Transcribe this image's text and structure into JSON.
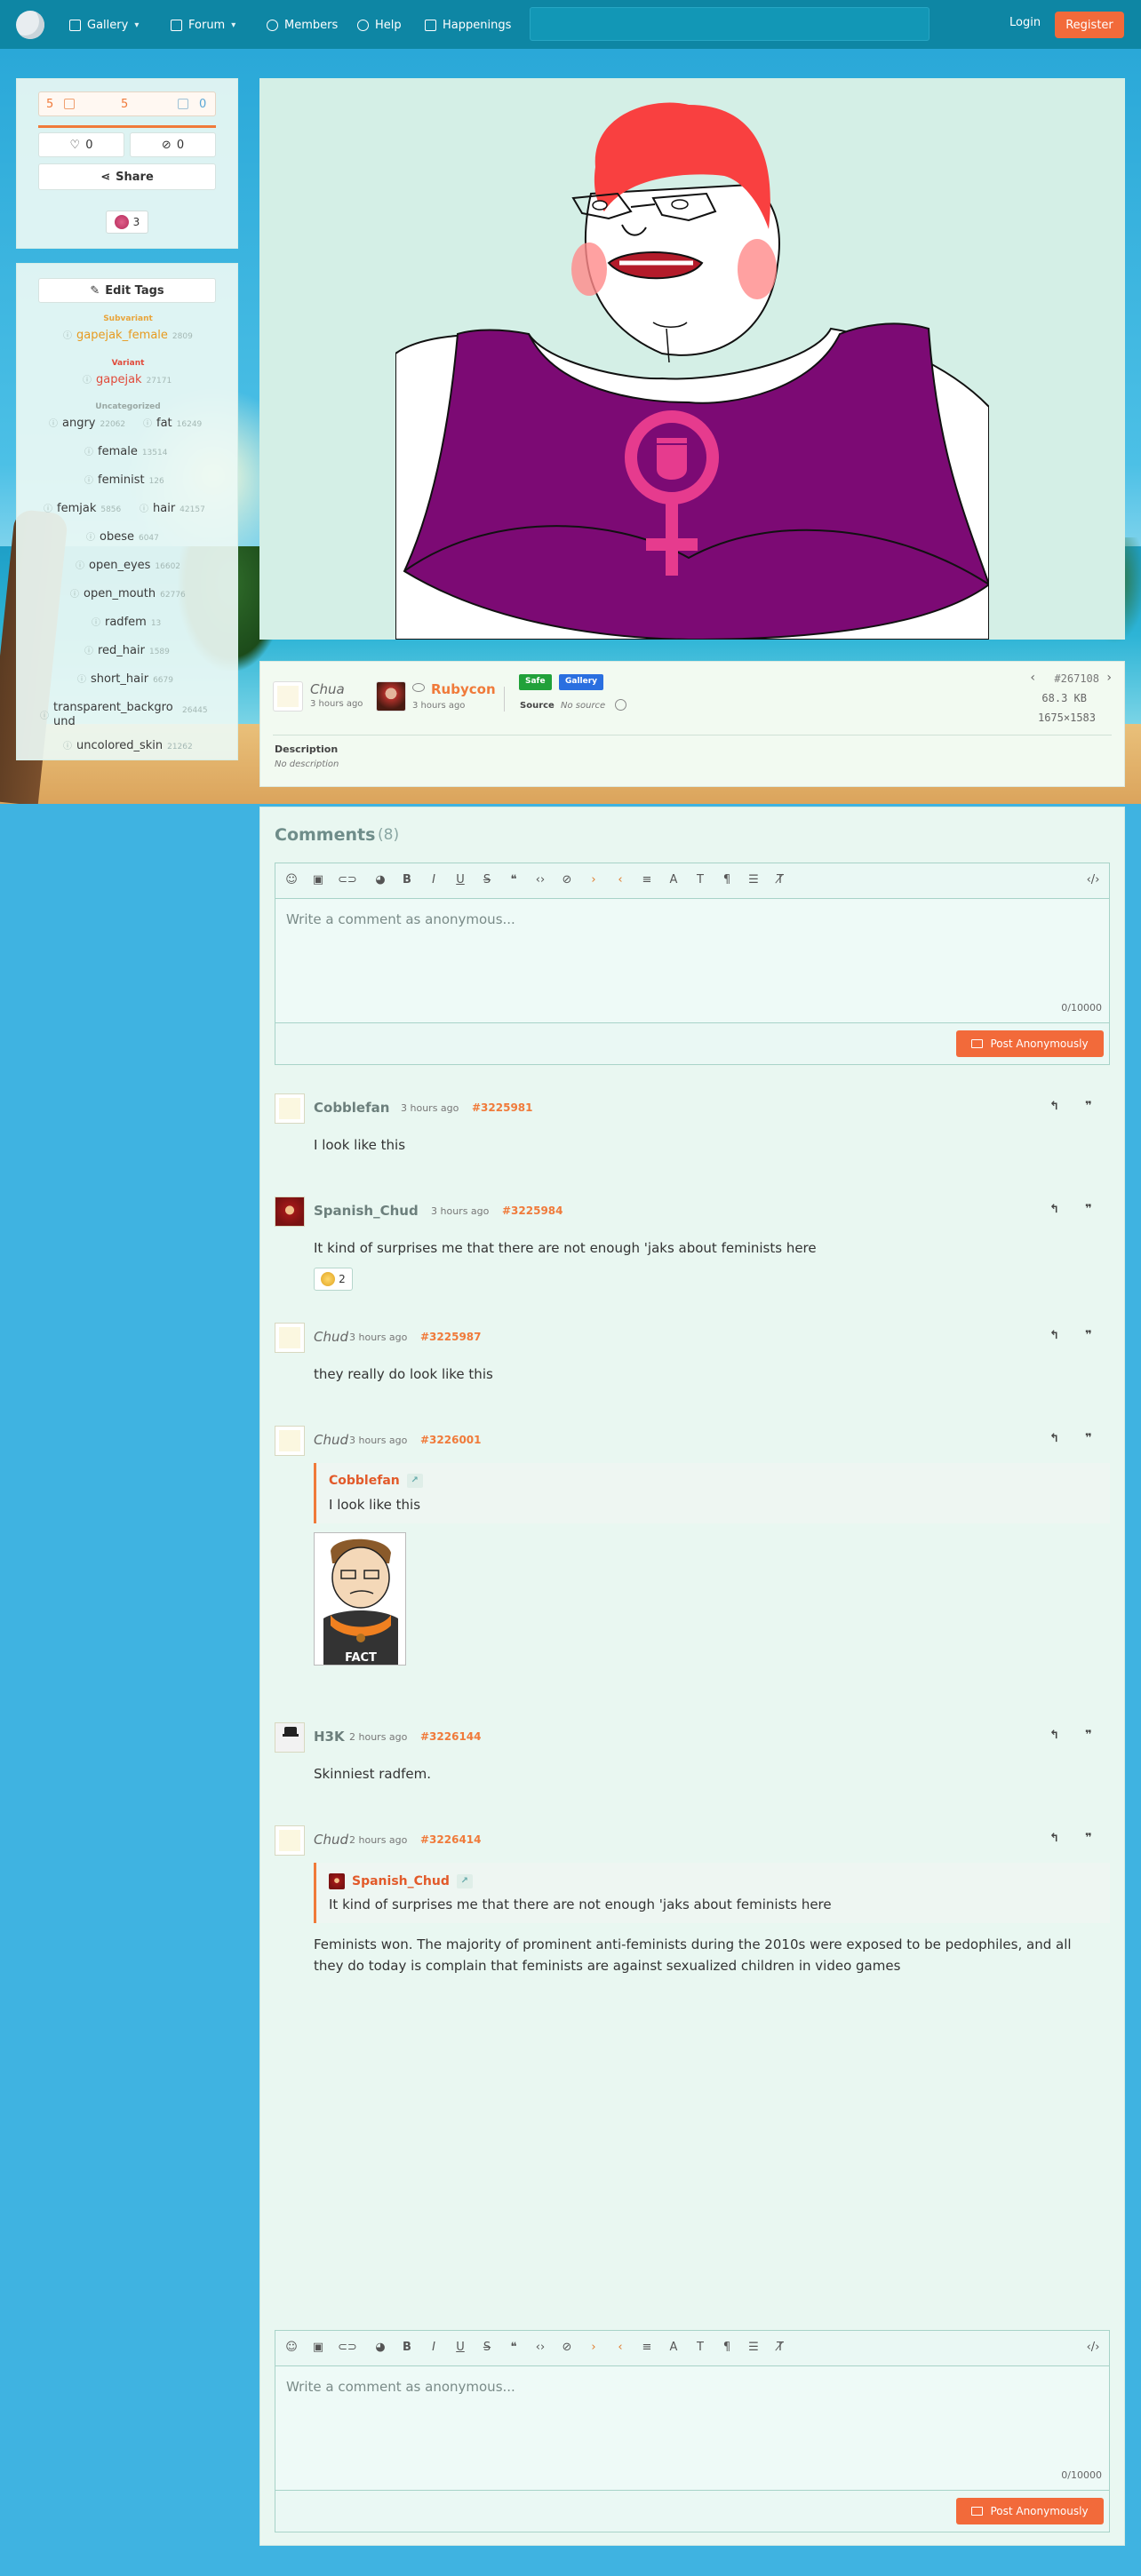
{
  "nav": {
    "items": [
      {
        "label": "Gallery",
        "has_dropdown": true,
        "icon": "image-icon"
      },
      {
        "label": "Forum",
        "has_dropdown": true,
        "icon": "chat-icon"
      },
      {
        "label": "Members",
        "has_dropdown": false,
        "icon": "user-icon"
      },
      {
        "label": "Help",
        "has_dropdown": false,
        "icon": "help-icon"
      },
      {
        "label": "Happenings",
        "has_dropdown": false,
        "icon": "book-icon"
      }
    ],
    "search_placeholder": "",
    "login_label": "Login",
    "register_label": "Register"
  },
  "vote": {
    "upvotes": "5",
    "score": "5",
    "downvotes": "0",
    "favorites": "0",
    "hides": "0",
    "share_label": "Share",
    "reaction_count": "3"
  },
  "tags": {
    "edit_label": "Edit Tags",
    "subvariant_heading": "Subvariant",
    "variant_heading": "Variant",
    "uncategorized_heading": "Uncategorized",
    "subvariant": [
      {
        "name": "gapejak_female",
        "count": "2809"
      }
    ],
    "variant": [
      {
        "name": "gapejak",
        "count": "27171"
      }
    ],
    "uncategorized": [
      {
        "name": "angry",
        "count": "22062"
      },
      {
        "name": "fat",
        "count": "16249"
      },
      {
        "name": "female",
        "count": "13514"
      },
      {
        "name": "feminist",
        "count": "126"
      },
      {
        "name": "femjak",
        "count": "5856"
      },
      {
        "name": "hair",
        "count": "42157"
      },
      {
        "name": "obese",
        "count": "6047"
      },
      {
        "name": "open_eyes",
        "count": "16602"
      },
      {
        "name": "open_mouth",
        "count": "62776"
      },
      {
        "name": "radfem",
        "count": "13"
      },
      {
        "name": "red_hair",
        "count": "1589"
      },
      {
        "name": "short_hair",
        "count": "6679"
      },
      {
        "name": "transparent_background",
        "count": "26445"
      },
      {
        "name": "uncolored_skin",
        "count": "21262"
      }
    ]
  },
  "info": {
    "uploader": "Chua",
    "uploader_time": "3 hours ago",
    "approver": "Rubycon",
    "approver_time": "3 hours ago",
    "rating_badge": "Safe",
    "category_badge": "Gallery",
    "source_label": "Source",
    "source_value": "No source",
    "image_id": "#267108",
    "file_size": "68.3 KB",
    "dimensions": "1675×1583",
    "description_label": "Description",
    "description_value": "No description"
  },
  "comments": {
    "title": "Comments",
    "count": "(8)",
    "editor_placeholder": "Write a comment as anonymous...",
    "char_count": "0/10000",
    "post_label": "Post Anonymously",
    "items": [
      {
        "author": "Cobblefan",
        "time": "3 hours ago",
        "id": "#3225981",
        "text": "I look like this"
      },
      {
        "author": "Spanish_Chud",
        "time": "3 hours ago",
        "id": "#3225984",
        "text": "It kind of surprises me that there are not enough 'jaks about feminists here",
        "reaction_count": "2"
      },
      {
        "author": "Chud",
        "time": "3 hours ago",
        "id": "#3225987",
        "text": "they really do look like this"
      },
      {
        "author": "Chud",
        "time": "3 hours ago",
        "id": "#3226001",
        "quote_author": "Cobblefan",
        "quote_text": "I look like this",
        "image_caption": "FACT"
      },
      {
        "author": "H3K",
        "time": "2 hours ago",
        "id": "#3226144",
        "text": "Skinniest radfem."
      },
      {
        "author": "Chud",
        "time": "2 hours ago",
        "id": "#3226414",
        "quote_author": "Spanish_Chud",
        "quote_text": "It kind of surprises me that there are not enough 'jaks about feminists here",
        "text": "Feminists won. The majority of prominent anti-feminists during the 2010s were exposed to be pedophiles, and all they do today is complain that feminists are against sexualized children in video games"
      }
    ]
  },
  "colors": {
    "accent": "#f26a3a",
    "nav_bg": "#0e86a4",
    "safe": "#21a13a",
    "gallery": "#2a6fe0"
  }
}
